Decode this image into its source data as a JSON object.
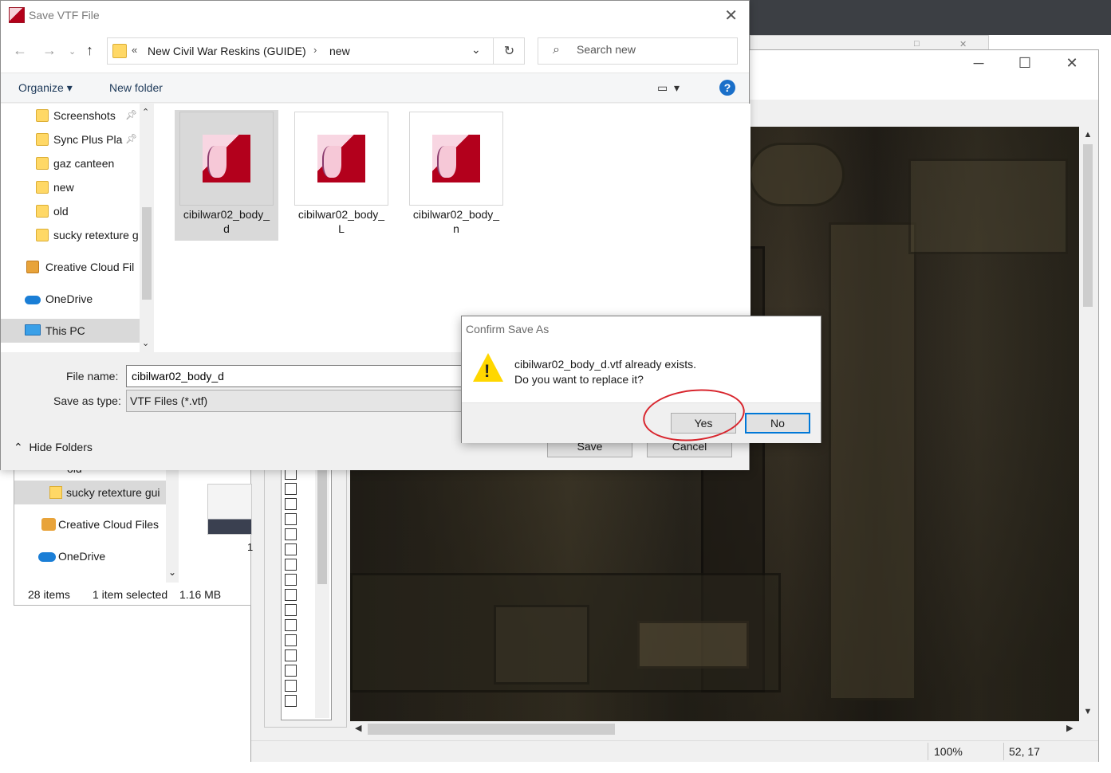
{
  "save_dialog": {
    "title": "Save VTF File",
    "address": {
      "crumb1": "New Civil War Reskins (GUIDE)",
      "crumb2": "new"
    },
    "search_placeholder": "Search new",
    "toolbar": {
      "organize": "Organize ▾",
      "new_folder": "New folder",
      "help": "?"
    },
    "nav_items": [
      {
        "label": "Screenshots",
        "pinned": true
      },
      {
        "label": "Sync Plus Pla",
        "pinned": true
      },
      {
        "label": "gaz canteen"
      },
      {
        "label": "new"
      },
      {
        "label": "old"
      },
      {
        "label": "sucky retexture g"
      },
      {
        "label": "Creative Cloud Fil"
      },
      {
        "label": "OneDrive"
      },
      {
        "label": "This PC"
      }
    ],
    "files": [
      {
        "name_line1": "cibilwar02_body_",
        "name_line2": "d"
      },
      {
        "name_line1": "cibilwar02_body_",
        "name_line2": "L"
      },
      {
        "name_line1": "cibilwar02_body_",
        "name_line2": "n"
      }
    ],
    "file_name_label": "File name:",
    "file_name_value": "cibilwar02_body_d",
    "save_type_label": "Save as type:",
    "save_type_value": "VTF Files (*.vtf)",
    "hide_folders": "Hide Folders",
    "save_button": "Save",
    "cancel_button": "Cancel"
  },
  "confirm_dialog": {
    "title": "Confirm Save As",
    "message_line1": "cibilwar02_body_d.vtf already exists.",
    "message_line2": "Do you want to replace it?",
    "yes": "Yes",
    "no": "No"
  },
  "explorer_behind": {
    "nav_items": [
      {
        "label": "old"
      },
      {
        "label": "sucky retexture gui"
      },
      {
        "label": "Creative Cloud Files"
      },
      {
        "label": "OneDrive"
      }
    ],
    "status_items": "28 items",
    "status_selected": "1 item selected",
    "status_size": "1.16 MB",
    "partial_label": "1"
  },
  "vtfedit": {
    "status_zoom": "100%",
    "status_coords": "52, 17"
  },
  "colors": {
    "accent": "#0078d7",
    "annotation_red": "#d8262e",
    "warning": "#ffd700"
  }
}
